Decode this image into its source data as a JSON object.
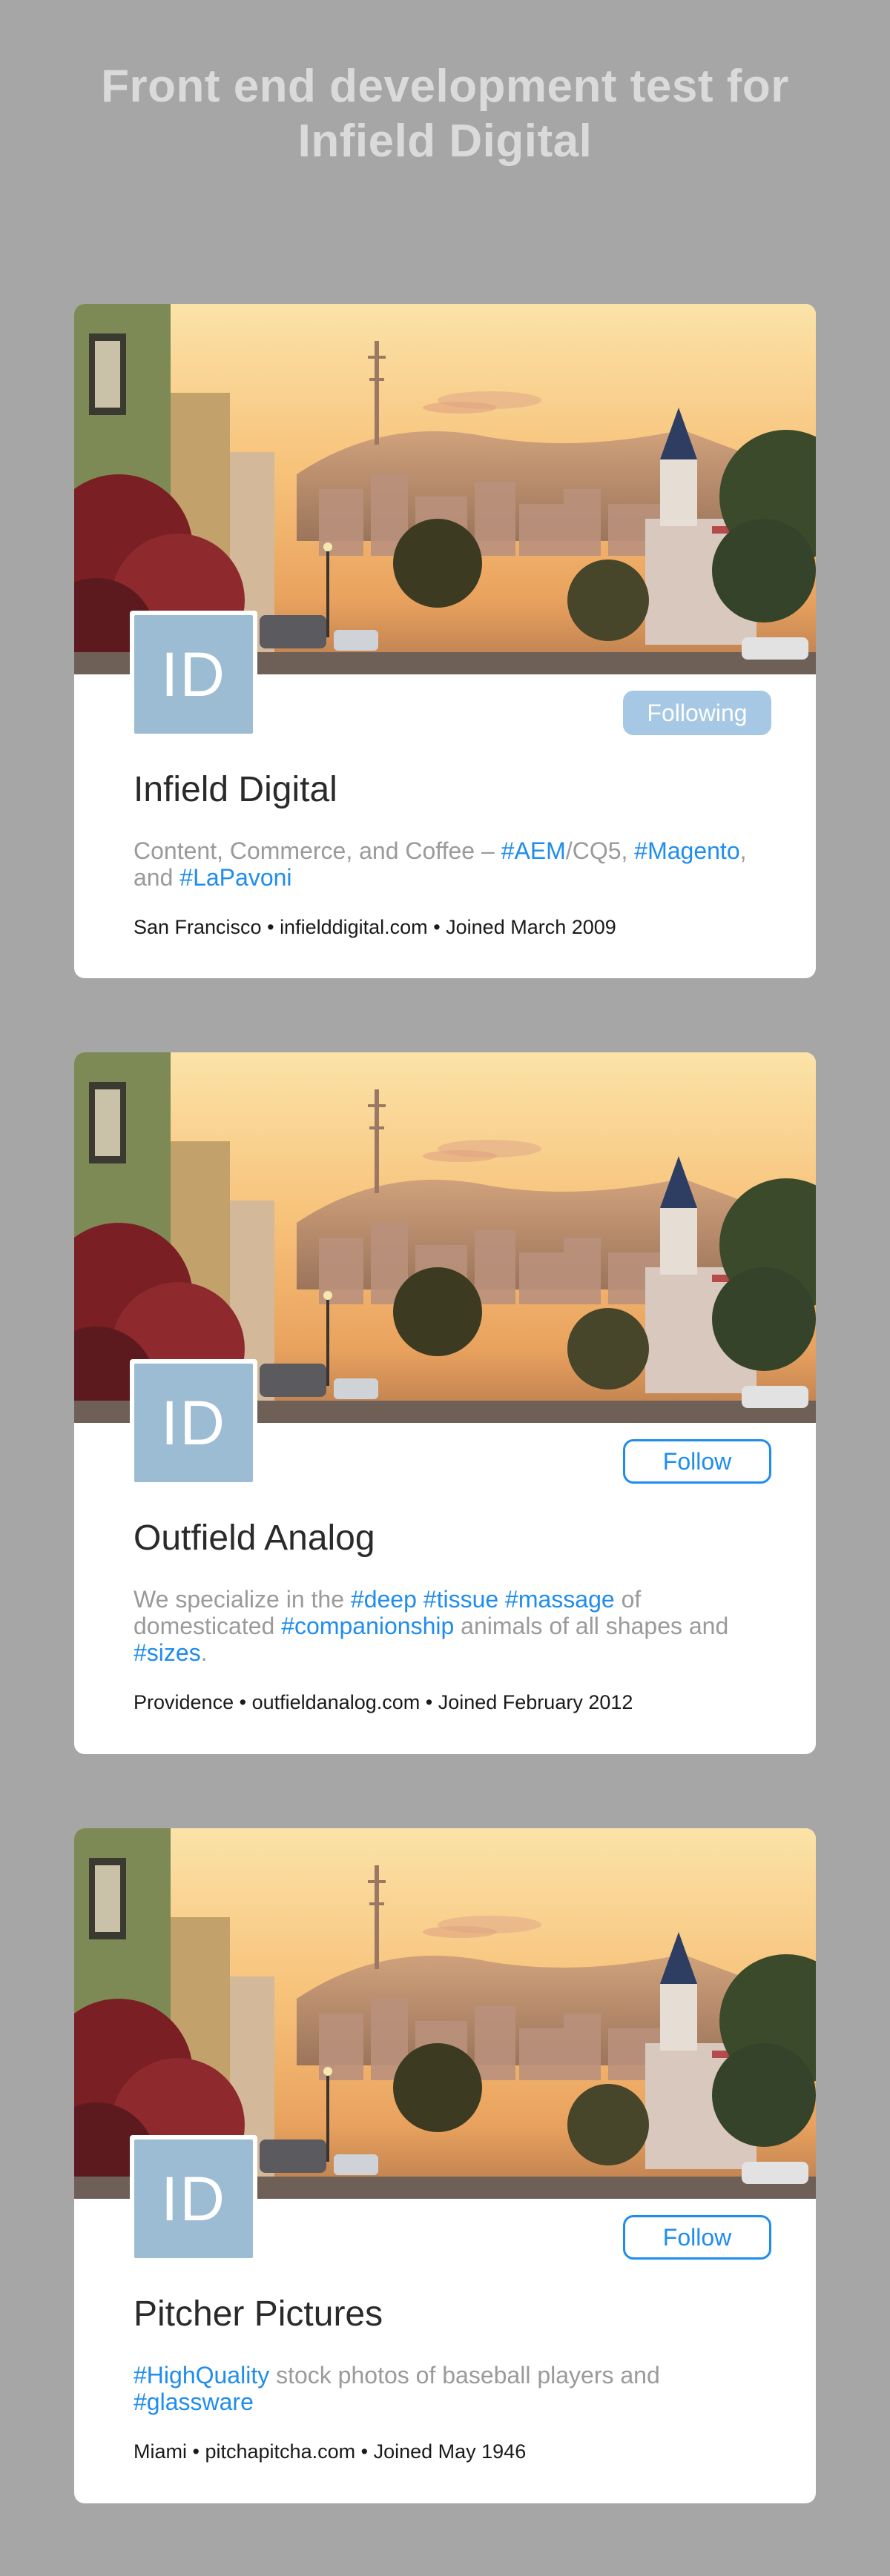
{
  "page": {
    "title_line1": "Front end development test for",
    "title_line2": "Infield Digital"
  },
  "colors": {
    "background": "#a6a6a6",
    "accent": "#1f8ded",
    "avatar": "#9bbcd3",
    "following_button": "#a6c8e4",
    "muted_text": "#9a9a9a"
  },
  "profiles": [
    {
      "avatar_initials": "ID",
      "button_label": "Following",
      "button_state": "following",
      "name": "Infield Digital",
      "bio": [
        {
          "text": "Content, Commerce, and Coffee – "
        },
        {
          "text": "#AEM",
          "tag": true
        },
        {
          "text": "/CQ5, "
        },
        {
          "text": "#Magento",
          "tag": true
        },
        {
          "text": ", and "
        },
        {
          "text": "#LaPavoni",
          "tag": true
        }
      ],
      "location": "San Francisco",
      "website": "infielddigital.com",
      "joined": "Joined March 2009"
    },
    {
      "avatar_initials": "ID",
      "button_label": "Follow",
      "button_state": "follow",
      "name": "Outfield Analog",
      "bio": [
        {
          "text": "We specialize in the "
        },
        {
          "text": "#deep",
          "tag": true
        },
        {
          "text": " "
        },
        {
          "text": "#tissue",
          "tag": true
        },
        {
          "text": " "
        },
        {
          "text": "#massage",
          "tag": true
        },
        {
          "text": " of domesticated "
        },
        {
          "text": "#companionship",
          "tag": true
        },
        {
          "text": " animals of all shapes and "
        },
        {
          "text": "#sizes",
          "tag": true
        },
        {
          "text": "."
        }
      ],
      "location": "Providence",
      "website": "outfieldanalog.com",
      "joined": "Joined February 2012"
    },
    {
      "avatar_initials": "ID",
      "button_label": "Follow",
      "button_state": "follow",
      "name": "Pitcher Pictures",
      "bio": [
        {
          "text": "#HighQuality",
          "tag": true
        },
        {
          "text": " stock photos of baseball players and "
        },
        {
          "text": "#glassware",
          "tag": true
        }
      ],
      "location": "Miami",
      "website": "pitchapitcha.com",
      "joined": "Joined May 1946"
    }
  ]
}
